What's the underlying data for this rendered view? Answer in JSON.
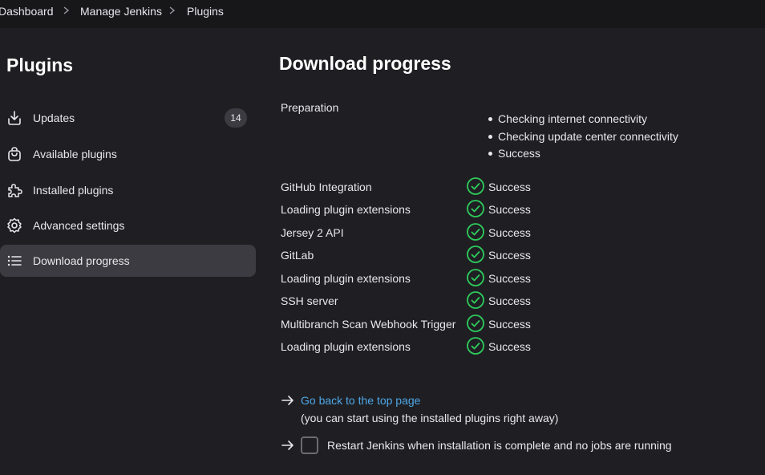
{
  "breadcrumbs": [
    "Dashboard",
    "Manage Jenkins",
    "Plugins"
  ],
  "sidebar": {
    "title": "Plugins",
    "items": [
      {
        "label": "Updates",
        "icon": "download-icon",
        "badge": "14"
      },
      {
        "label": "Available plugins",
        "icon": "shopping-bag-icon"
      },
      {
        "label": "Installed plugins",
        "icon": "puzzle-icon"
      },
      {
        "label": "Advanced settings",
        "icon": "gear-icon"
      },
      {
        "label": "Download progress",
        "icon": "list-icon",
        "active": true
      }
    ]
  },
  "main": {
    "title": "Download progress",
    "preparation": {
      "label": "Preparation",
      "steps": [
        "Checking internet connectivity",
        "Checking update center connectivity",
        "Success"
      ]
    },
    "rows": [
      {
        "name": "GitHub Integration",
        "status": "Success"
      },
      {
        "name": "Loading plugin extensions",
        "status": "Success"
      },
      {
        "name": "Jersey 2 API",
        "status": "Success"
      },
      {
        "name": "GitLab",
        "status": "Success"
      },
      {
        "name": "Loading plugin extensions",
        "status": "Success"
      },
      {
        "name": "SSH server",
        "status": "Success"
      },
      {
        "name": "Multibranch Scan Webhook Trigger",
        "status": "Success"
      },
      {
        "name": "Loading plugin extensions",
        "status": "Success"
      }
    ],
    "back_link": "Go back to the top page",
    "back_note": "(you can start using the installed plugins right away)",
    "restart_label": "Restart Jenkins when installation is complete and no jobs are running",
    "restart_checked": false
  },
  "colors": {
    "background": "#1f1f23",
    "success": "#2ecc5c",
    "link": "#4ea6e6",
    "active_item": "#3b3b41"
  }
}
